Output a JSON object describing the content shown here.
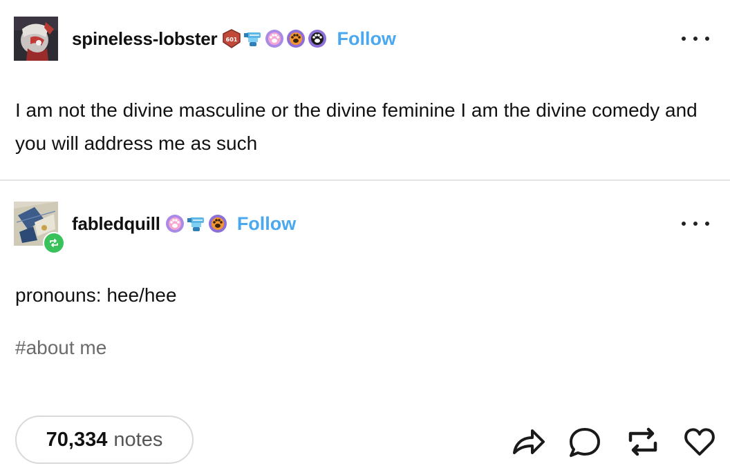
{
  "original_post": {
    "username": "spineless-lobster",
    "follow_label": "Follow",
    "badge_text": "601",
    "text": "I am not the divine masculine or the divine feminine I am the divine comedy and you will address me as such"
  },
  "reblog": {
    "username": "fabledquill",
    "follow_label": "Follow",
    "text": "pronouns: hee/hee",
    "tag": "#about me"
  },
  "footer": {
    "notes_count": "70,334",
    "notes_label": "notes"
  },
  "colors": {
    "follow": "#4aa8f0",
    "reblog_badge": "#39c25b",
    "divider": "#e3e3e3"
  },
  "icons": [
    "avatar-lobster",
    "badge-shield",
    "badge-robot",
    "badge-paw",
    "more-dots",
    "share-icon",
    "reply-icon",
    "reblog-icon",
    "like-icon"
  ]
}
